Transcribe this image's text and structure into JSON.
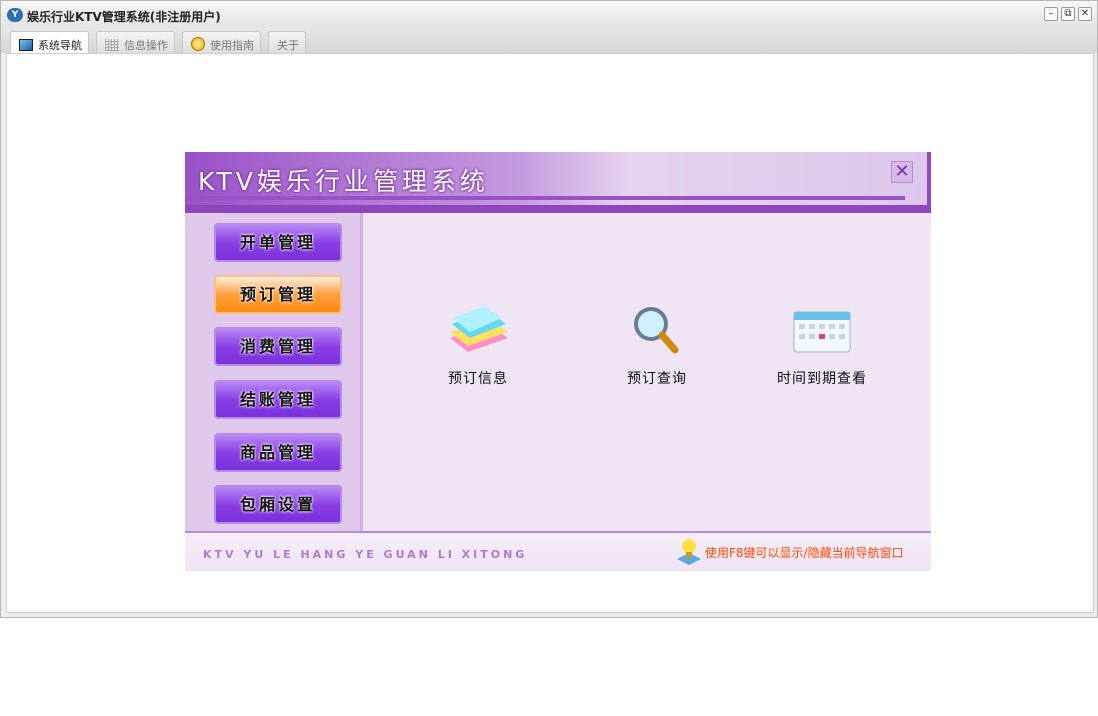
{
  "window": {
    "title": "娱乐行业KTV管理系统(非注册用户)",
    "minimize": "–",
    "restore": "⧉",
    "close": "✕"
  },
  "tabs": [
    {
      "label": "系统导航"
    },
    {
      "label": "信息操作"
    },
    {
      "label": "使用指南"
    },
    {
      "label": "关于"
    }
  ],
  "panel": {
    "title": "KTV娱乐行业管理系统",
    "close": "✕",
    "nav": [
      {
        "label": "开单管理"
      },
      {
        "label": "预订管理"
      },
      {
        "label": "消费管理"
      },
      {
        "label": "结账管理"
      },
      {
        "label": "商品管理"
      },
      {
        "label": "包厢设置"
      }
    ],
    "items": [
      {
        "label": "预订信息"
      },
      {
        "label": "预订查询"
      },
      {
        "label": "时间到期查看"
      }
    ],
    "footer_en": "KTV YU LE HANG YE GUAN LI XITONG",
    "footer_tip": "使用F8键可以显示/隐藏当前导航窗口"
  }
}
